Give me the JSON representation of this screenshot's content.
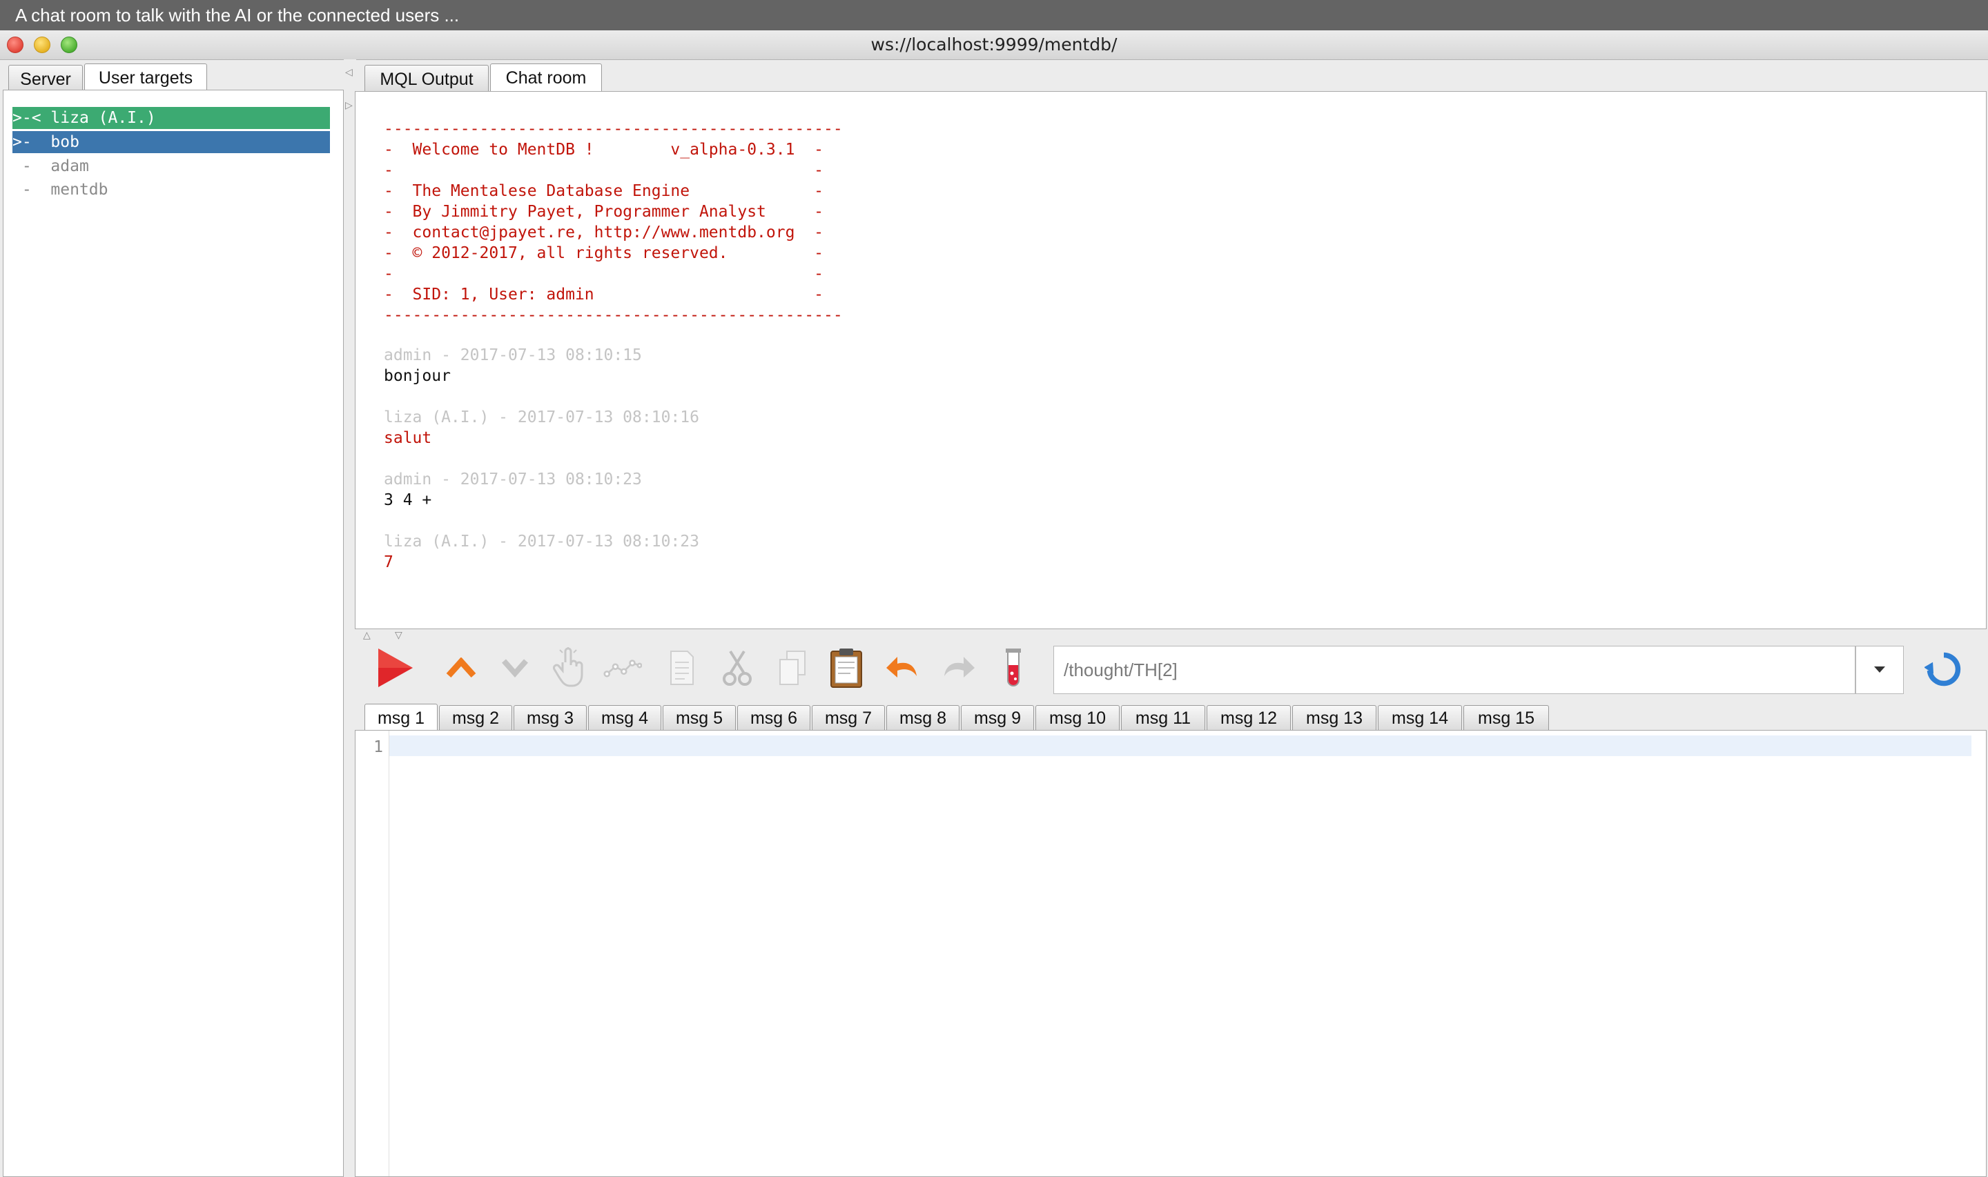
{
  "tooltip": "A chat room to talk with the AI or the connected users ...",
  "window": {
    "title": "ws://localhost:9999/mentdb/"
  },
  "left_tabs": [
    {
      "label": "Server",
      "active": false
    },
    {
      "label": "User targets",
      "active": true
    }
  ],
  "users": [
    {
      "prefix": ">-<",
      "name": "liza (A.I.)",
      "state": "ai-selected"
    },
    {
      "prefix": ">-",
      "name": "bob",
      "state": "selected"
    },
    {
      "prefix": " -",
      "name": "adam",
      "state": "normal"
    },
    {
      "prefix": " -",
      "name": "mentdb",
      "state": "normal"
    }
  ],
  "right_tabs": [
    {
      "label": "MQL Output",
      "active": false
    },
    {
      "label": "Chat room",
      "active": true
    }
  ],
  "banner": [
    "------------------------------------------------",
    "-  Welcome to MentDB !        v_alpha-0.3.1  -",
    "-                                            -",
    "-  The Mentalese Database Engine             -",
    "-  By Jimmitry Payet, Programmer Analyst     -",
    "-  contact@jpayet.re, http://www.mentdb.org  -",
    "-  © 2012-2017, all rights reserved.         -",
    "-                                            -",
    "-  SID: 1, User: admin                       -",
    "------------------------------------------------"
  ],
  "messages": [
    {
      "meta": "admin - 2017-07-13 08:10:15",
      "text": "bonjour",
      "from_ai": false
    },
    {
      "meta": "liza (A.I.) - 2017-07-13 08:10:16",
      "text": "salut",
      "from_ai": true
    },
    {
      "meta": "admin - 2017-07-13 08:10:23",
      "text": "3 4 +",
      "from_ai": false
    },
    {
      "meta": "liza (A.I.) - 2017-07-13 08:10:23",
      "text": "7",
      "from_ai": true
    }
  ],
  "toolbar": {
    "icons": [
      "run-icon",
      "move-up-icon",
      "move-down-icon",
      "hand-pointer-icon",
      "graph-icon",
      "document-icon",
      "cut-icon",
      "copy-icon",
      "paste-icon",
      "undo-icon",
      "redo-icon",
      "test-tube-icon"
    ],
    "path_value": "/thought/TH[2]",
    "refresh_icon": "refresh-icon"
  },
  "editor_tabs": [
    "msg 1",
    "msg 2",
    "msg 3",
    "msg 4",
    "msg 5",
    "msg 6",
    "msg 7",
    "msg 8",
    "msg 9",
    "msg 10",
    "msg 11",
    "msg 12",
    "msg 13",
    "msg 14",
    "msg 15"
  ],
  "editor_active_tab": "msg 1",
  "editor": {
    "line_number": "1"
  },
  "colors": {
    "ai_highlight": "#3caa72",
    "selection": "#3c76ad",
    "banner_red": "#c1140a"
  }
}
